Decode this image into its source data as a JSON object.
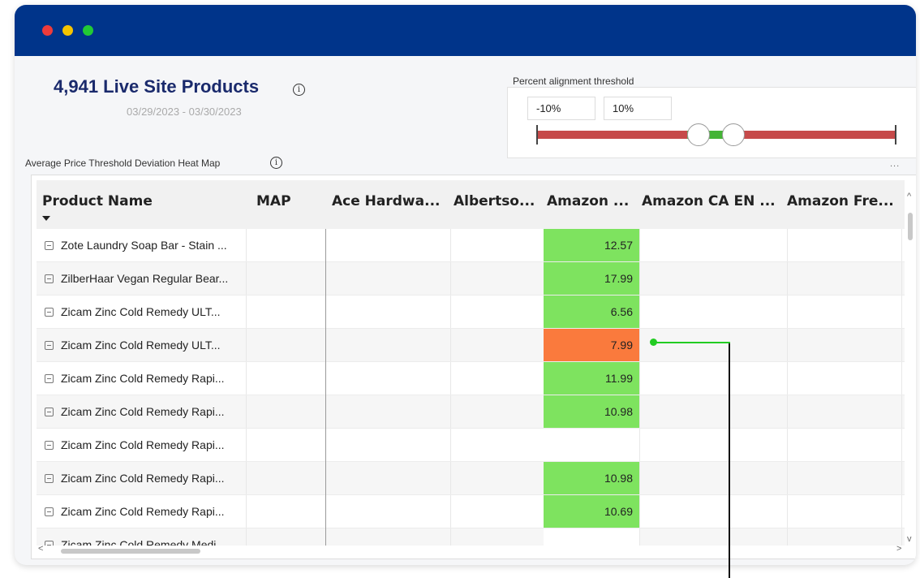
{
  "window": {
    "controls": [
      "close",
      "minimize",
      "maximize"
    ],
    "colors": {
      "titlebar": "#00348a",
      "close": "#ee3b3b",
      "minimize": "#f5c400",
      "maximize": "#22c935"
    }
  },
  "header": {
    "title": "4,941 Live Site Products",
    "info_icon": "info-icon",
    "date_range": "03/29/2023 - 03/30/2023"
  },
  "threshold": {
    "label": "Percent alignment threshold",
    "min_value": "-10%",
    "max_value": "10%",
    "colors": {
      "outside": "#c64a4a",
      "inside": "#44b436"
    }
  },
  "heatmap": {
    "title": "Average Price Threshold Deviation Heat Map",
    "more_label": "...",
    "columns": [
      "Product Name",
      "MAP",
      "Ace Hardwa...",
      "Albertso...",
      "Amazon ...",
      "Amazon CA EN ...",
      "Amazon Fre..."
    ],
    "rows": [
      {
        "name": "Zote Laundry Soap Bar - Stain ...",
        "amazon": "12.57",
        "status": "within"
      },
      {
        "name": "ZilberHaar Vegan Regular Bear...",
        "amazon": "17.99",
        "status": "within"
      },
      {
        "name": "Zicam Zinc Cold Remedy ULT...",
        "amazon": "6.56",
        "status": "within"
      },
      {
        "name": "Zicam Zinc Cold Remedy ULT...",
        "amazon": "7.99",
        "status": "outside"
      },
      {
        "name": "Zicam Zinc Cold Remedy Rapi...",
        "amazon": "11.99",
        "status": "within"
      },
      {
        "name": "Zicam Zinc Cold Remedy Rapi...",
        "amazon": "10.98",
        "status": "within"
      },
      {
        "name": "Zicam Zinc Cold Remedy Rapi...",
        "amazon": "",
        "status": "none"
      },
      {
        "name": "Zicam Zinc Cold Remedy Rapi...",
        "amazon": "10.98",
        "status": "within"
      },
      {
        "name": "Zicam Zinc Cold Remedy Rapi...",
        "amazon": "10.69",
        "status": "within"
      },
      {
        "name": "Zicam Zinc Cold Remedy Medi...",
        "amazon": "",
        "status": "none"
      }
    ],
    "colors": {
      "within": "#7ee35f",
      "outside": "#fa7a3d",
      "none": "#ffffff"
    },
    "scroll": {
      "left": "<",
      "right": ">",
      "up": "^",
      "down": "v"
    }
  },
  "annotation": {
    "color": "#22cc22"
  }
}
